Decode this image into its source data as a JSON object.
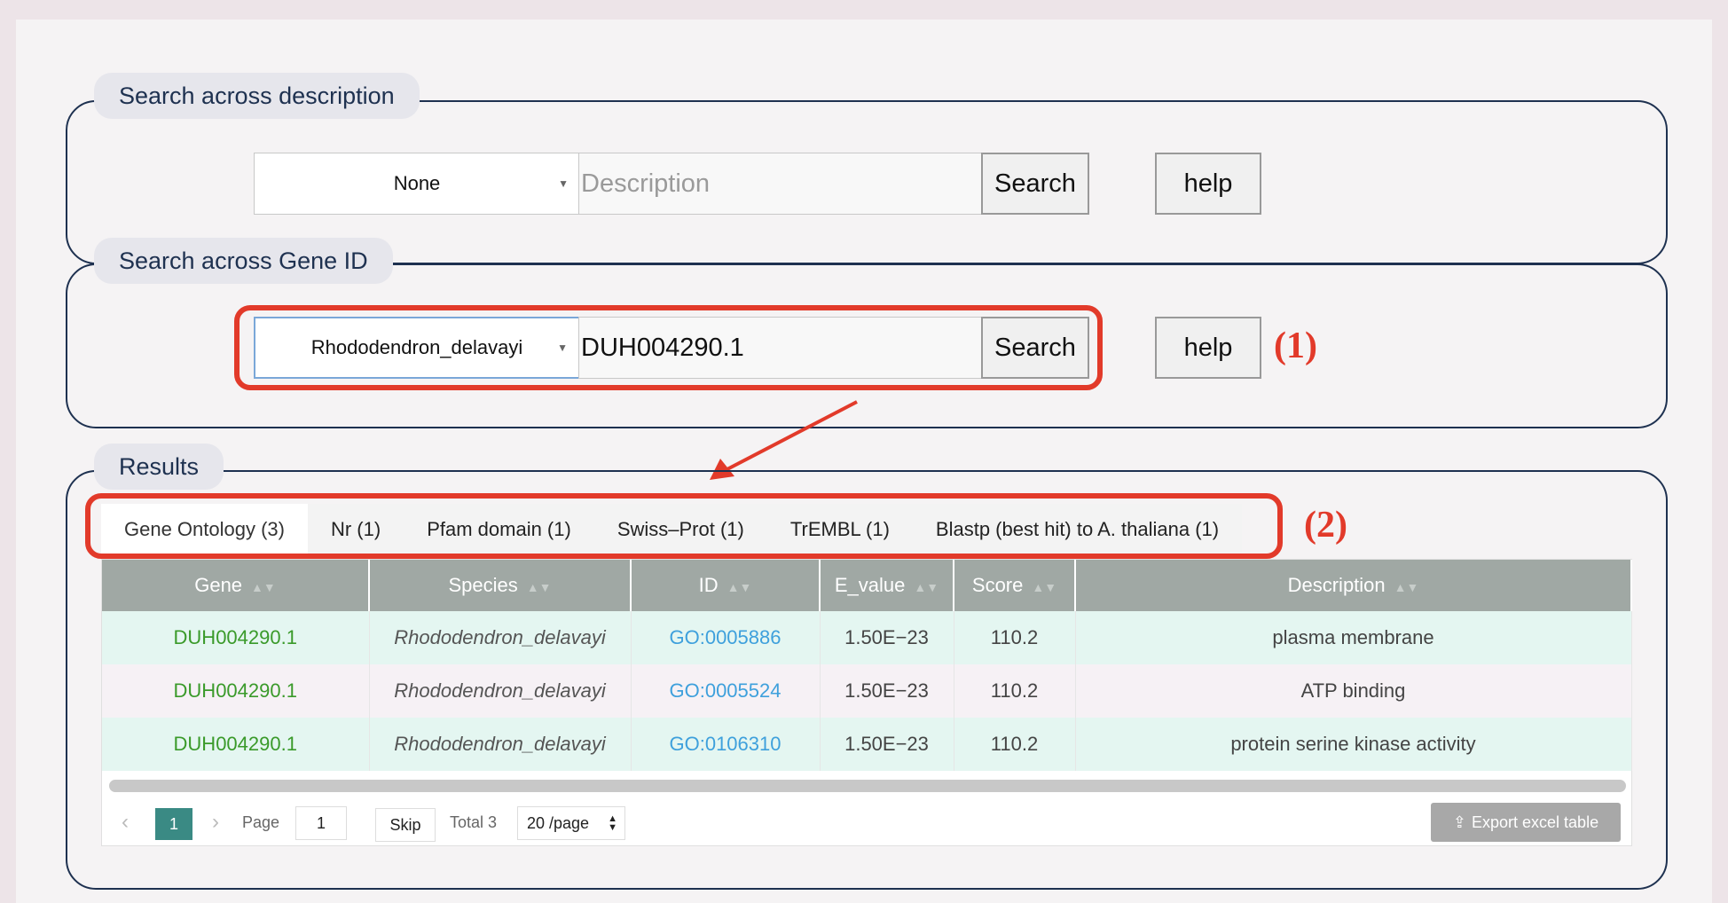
{
  "desc_section": {
    "legend": "Search across description",
    "select_value": "None",
    "input_placeholder": "Description",
    "search_label": "Search",
    "help_label": "help"
  },
  "gene_section": {
    "legend": "Search across Gene ID",
    "select_value": "Rhododendron_delavayi",
    "input_value": "DUH004290.1",
    "search_label": "Search",
    "help_label": "help",
    "annotation": "(1)"
  },
  "results": {
    "legend": "Results",
    "annotation": "(2)",
    "tabs": [
      {
        "label": "Gene Ontology (3)"
      },
      {
        "label": "Nr (1)"
      },
      {
        "label": "Pfam domain (1)"
      },
      {
        "label": "Swiss–Prot (1)"
      },
      {
        "label": "TrEMBL (1)"
      },
      {
        "label": "Blastp (best hit) to A. thaliana (1)"
      }
    ],
    "columns": [
      "Gene",
      "Species",
      "ID",
      "E_value",
      "Score",
      "Description"
    ],
    "rows": [
      {
        "gene": "DUH004290.1",
        "species": "Rhododendron_delavayi",
        "id": "GO:0005886",
        "e_value": "1.50E−23",
        "score": "110.2",
        "description": "plasma membrane"
      },
      {
        "gene": "DUH004290.1",
        "species": "Rhododendron_delavayi",
        "id": "GO:0005524",
        "e_value": "1.50E−23",
        "score": "110.2",
        "description": "ATP binding"
      },
      {
        "gene": "DUH004290.1",
        "species": "Rhododendron_delavayi",
        "id": "GO:0106310",
        "e_value": "1.50E−23",
        "score": "110.2",
        "description": "protein serine kinase activity"
      }
    ],
    "pager": {
      "current_page": "1",
      "page_label": "Page",
      "page_input": "1",
      "skip_label": "Skip",
      "total_label": "Total 3",
      "page_size": "20 /page"
    },
    "export_label": "Export excel table"
  },
  "colors": {
    "accent_red": "#e23a2a",
    "panel_border": "#1e3150",
    "gene_green": "#3a9a2a",
    "go_blue": "#3ea0dc",
    "pager_teal": "#3a8a84"
  }
}
